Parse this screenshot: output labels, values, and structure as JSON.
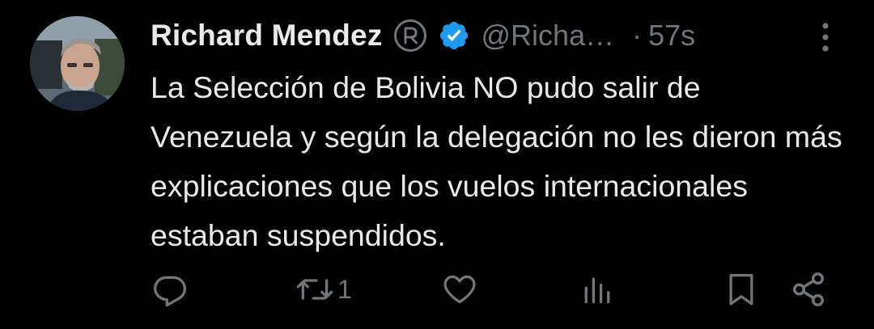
{
  "tweet": {
    "author": {
      "display_name": "Richard Mendez",
      "handle": "@Richa…",
      "registered_icon": "registered-trademark-icon",
      "verified_icon": "verified-badge-icon",
      "verified_color": "#1d9bf0"
    },
    "separator": "·",
    "time": "57s",
    "text": "La Selección de Bolivia NO pudo salir de Venezuela y según la delegación no les dieron más explicaciones que los vuelos internacionales estaban suspendidos.",
    "actions": {
      "reply_icon": "reply-icon",
      "retweet_icon": "retweet-icon",
      "retweet_count": "1",
      "like_icon": "heart-icon",
      "views_icon": "views-chart-icon",
      "bookmark_icon": "bookmark-icon",
      "share_icon": "share-icon"
    },
    "more_icon": "more-vertical-icon"
  },
  "colors": {
    "background": "#000000",
    "text": "#e7e9ea",
    "secondary": "#71767b",
    "accent": "#1d9bf0"
  }
}
